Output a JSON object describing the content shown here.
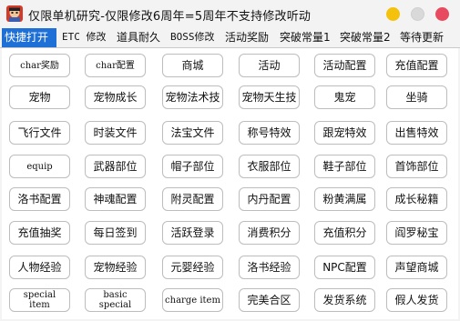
{
  "window": {
    "title": "仅限单机研究-仅限修改6周年=5周年不支持修改听动",
    "controls": {
      "minimize_color": "#f4c20d",
      "maximize_color": "#d9d9d9",
      "close_color": "#e84a5f"
    }
  },
  "accent_color": "#1e6fd6",
  "tabs": [
    {
      "label": "快捷打开",
      "active": true
    },
    {
      "label": "ETC 修改",
      "active": false
    },
    {
      "label": "道具耐久",
      "active": false
    },
    {
      "label": "BOSS修改",
      "active": false
    },
    {
      "label": "活动奖励",
      "active": false
    },
    {
      "label": "突破常量1",
      "active": false
    },
    {
      "label": "突破常量2",
      "active": false
    },
    {
      "label": "等待更新",
      "active": false
    }
  ],
  "buttons": [
    [
      "char奖励",
      "char配置",
      "商城",
      "活动",
      "活动配置",
      "充值配置"
    ],
    [
      "宠物",
      "宠物成长",
      "宠物法术技",
      "宠物天生技",
      "鬼宠",
      "坐骑"
    ],
    [
      "飞行文件",
      "时装文件",
      "法宝文件",
      "称号特效",
      "跟宠特效",
      "出售特效"
    ],
    [
      "equip",
      "武器部位",
      "帽子部位",
      "衣服部位",
      "鞋子部位",
      "首饰部位"
    ],
    [
      "洛书配置",
      "神魂配置",
      "附灵配置",
      "内丹配置",
      "粉黄满属",
      "成长秘籍"
    ],
    [
      "充值抽奖",
      "每日签到",
      "活跃登录",
      "消费积分",
      "充值积分",
      "阎罗秘宝"
    ],
    [
      "人物经验",
      "宠物经验",
      "元婴经验",
      "洛书经验",
      "NPC配置",
      "声望商城"
    ],
    [
      "special\nitem",
      "basic\nspecial",
      "charge item",
      "完美合区",
      "发货系统",
      "假人发货"
    ]
  ]
}
